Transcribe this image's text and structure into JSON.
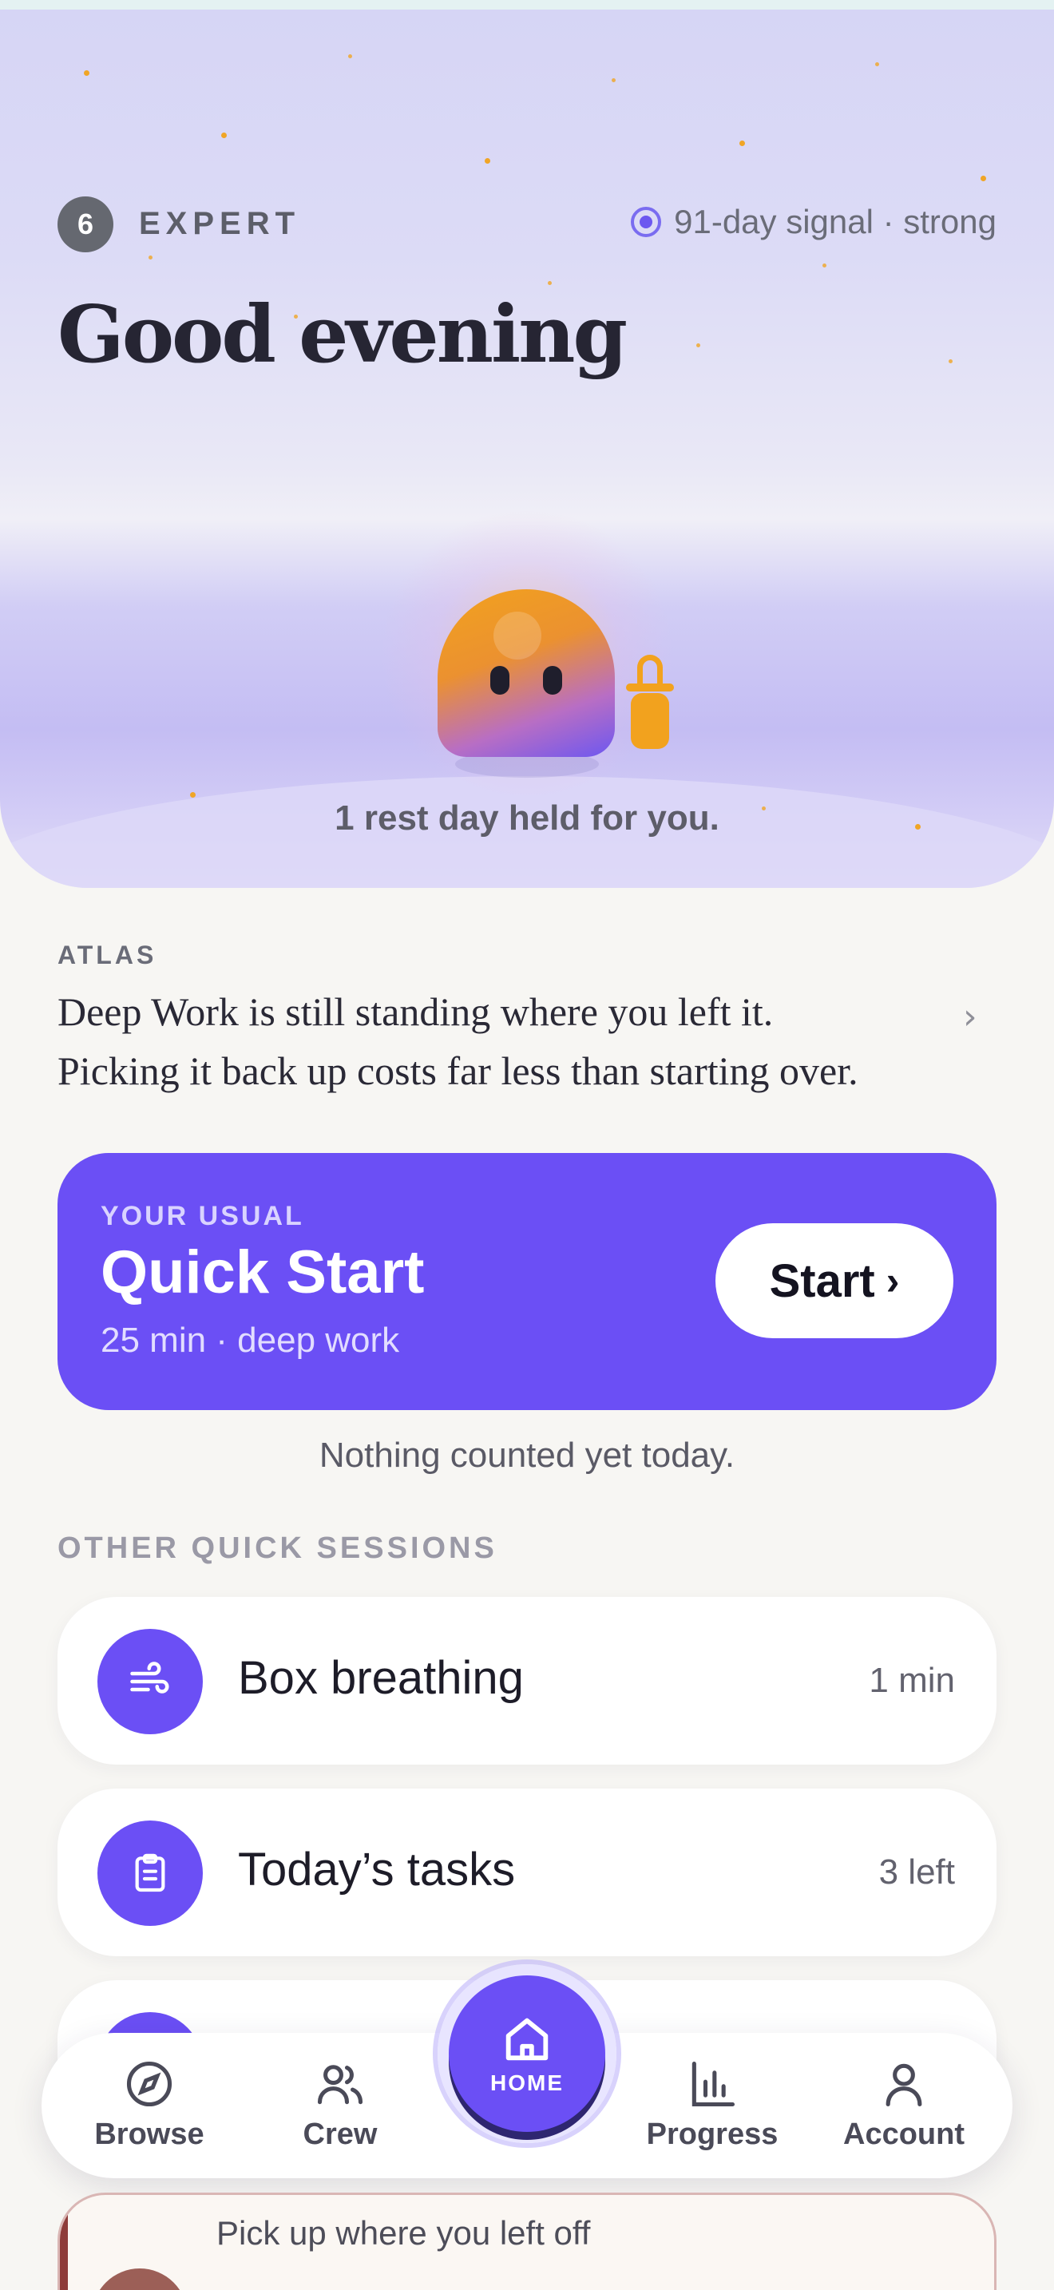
{
  "header": {
    "level_number": "6",
    "level_label": "EXPERT",
    "signal_text": "91-day signal · strong",
    "greeting": "Good evening"
  },
  "hero": {
    "rest_message": "1 rest day held for you."
  },
  "atlas": {
    "label": "ATLAS",
    "message_line1": "Deep Work is still standing where you left it.",
    "message_line2": "Picking it back up costs far less than starting over.",
    "chevron": "›"
  },
  "usual": {
    "eyebrow": "YOUR USUAL",
    "title": "Quick Start",
    "subtitle": "25 min · deep work",
    "button_label": "Start",
    "button_chevron": "›"
  },
  "today_status": "Nothing counted yet today.",
  "other_sessions": {
    "label": "OTHER QUICK SESSIONS",
    "items": [
      {
        "name": "Box breathing",
        "meta": "1 min",
        "icon": "wind-icon"
      },
      {
        "name": "Today’s tasks",
        "meta": "3 left",
        "icon": "clipboard-icon"
      },
      {
        "name": "",
        "meta": "",
        "icon": "session-icon"
      }
    ]
  },
  "nav": {
    "items": [
      {
        "label": "Browse",
        "icon": "compass-icon"
      },
      {
        "label": "Crew",
        "icon": "people-icon"
      },
      {
        "label": "HOME",
        "icon": "home-icon"
      },
      {
        "label": "Progress",
        "icon": "bar-chart-icon"
      },
      {
        "label": "Account",
        "icon": "user-icon"
      }
    ]
  },
  "resume": {
    "text": "Pick up where you left off"
  },
  "colors": {
    "accent": "#6b4ff5",
    "mascot_orange": "#f2a21e",
    "background": "#f7f6f3"
  }
}
